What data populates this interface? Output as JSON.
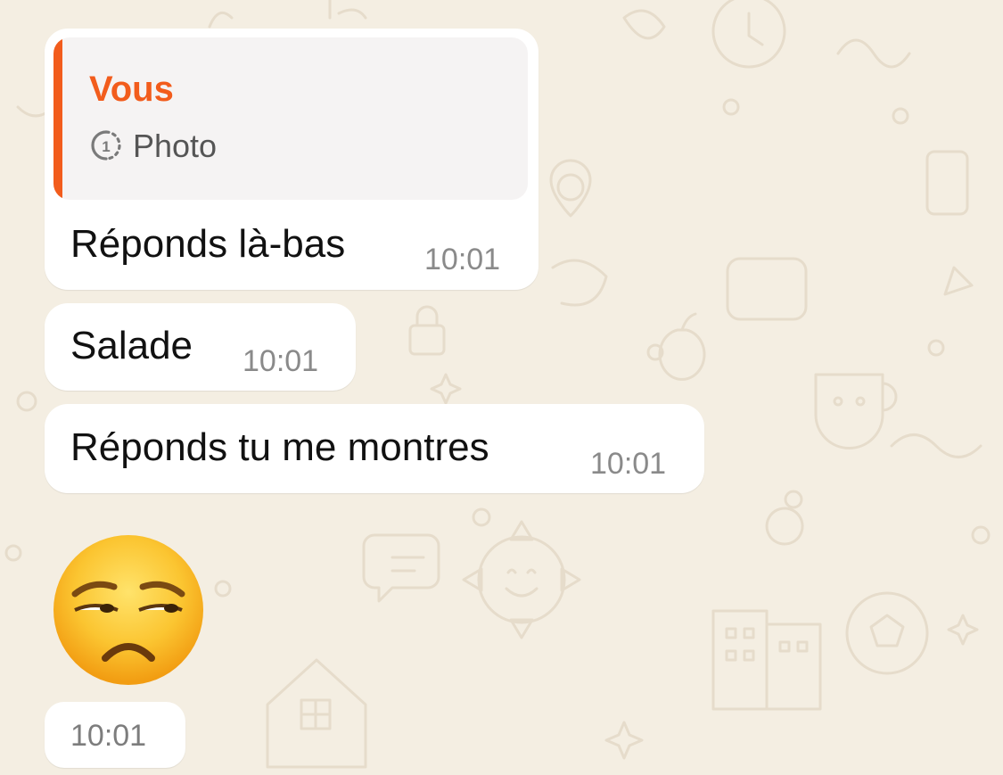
{
  "chat": {
    "reply_message": {
      "quote": {
        "author": "Vous",
        "icon": "view-once-icon",
        "body": "Photo"
      },
      "text": "Réponds là-bas",
      "time": "10:01"
    },
    "messages": [
      {
        "text": "Salade",
        "time": "10:01"
      },
      {
        "text": "Réponds tu me montres",
        "time": "10:01"
      }
    ],
    "emoji_message": {
      "emoji": "unamused-face",
      "time": "10:01"
    }
  },
  "theme": {
    "accent": "#f25c1c",
    "wallpaper": "#f4eee2",
    "bubble": "#ffffff"
  }
}
